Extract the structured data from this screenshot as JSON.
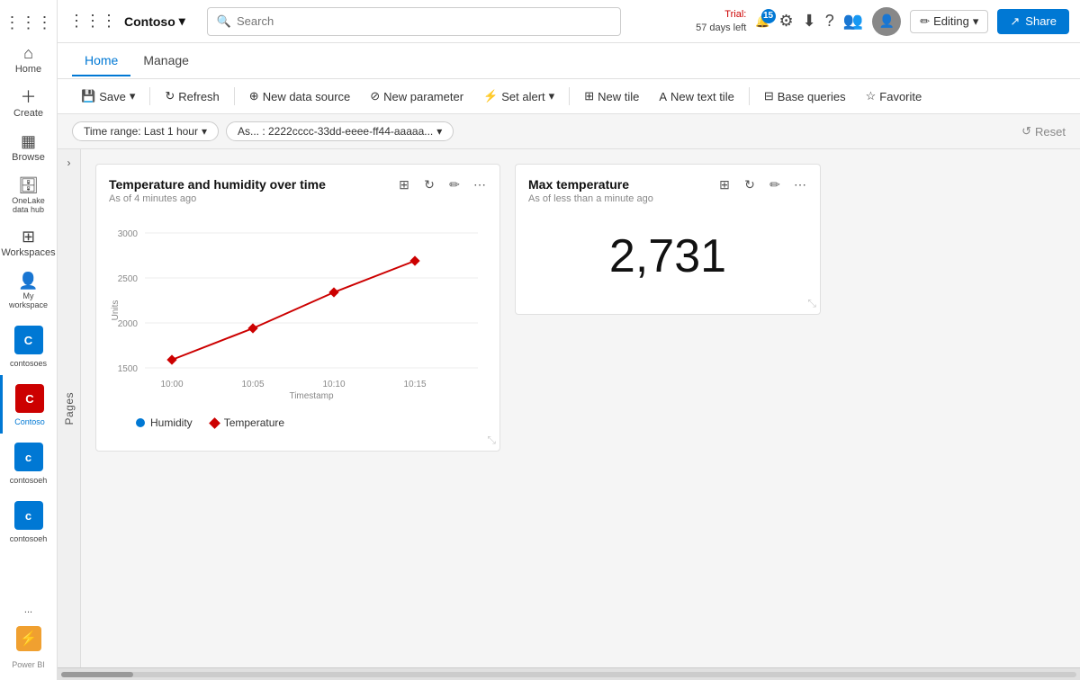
{
  "topbar": {
    "grid_icon": "⋮⋮⋮",
    "workspace": "Contoso",
    "workspace_chevron": "▾",
    "search_placeholder": "Search",
    "trial": {
      "label": "Trial:",
      "days": "57 days left"
    },
    "notification_count": "15",
    "editing_label": "Editing",
    "editing_chevron": "▾",
    "share_label": "Share",
    "share_icon": "↗"
  },
  "nav": {
    "tabs": [
      {
        "label": "Home",
        "active": true
      },
      {
        "label": "Manage",
        "active": false
      }
    ]
  },
  "toolbar": {
    "save_label": "Save",
    "refresh_label": "Refresh",
    "new_datasource_label": "New data source",
    "new_parameter_label": "New parameter",
    "set_alert_label": "Set alert",
    "new_tile_label": "New tile",
    "new_text_label": "New text tile",
    "base_queries_label": "Base queries",
    "favorite_label": "Favorite"
  },
  "filters": {
    "time_range": "Time range: Last 1 hour",
    "as_label": "As... : 2222cccc-33dd-eeee-ff44-aaaaa...",
    "reset_label": "Reset"
  },
  "sidebar": {
    "items": [
      {
        "label": "Home",
        "icon": "⌂",
        "active": false
      },
      {
        "label": "Create",
        "icon": "＋",
        "active": false
      },
      {
        "label": "Browse",
        "icon": "▦",
        "active": false
      },
      {
        "label": "OneLake data hub",
        "icon": "🗄",
        "active": false
      },
      {
        "label": "Workspaces",
        "icon": "⊞",
        "active": false
      },
      {
        "label": "My workspace",
        "icon": "👤",
        "active": false
      }
    ],
    "apps": [
      {
        "label": "contosoes",
        "letter": "C",
        "color": "#0078d4"
      },
      {
        "label": "Contoso",
        "letter": "C",
        "color": "#c00"
      },
      {
        "label": "contosoeh",
        "letter": "c",
        "color": "#0078d4"
      },
      {
        "label": "contosoeh",
        "letter": "c",
        "color": "#0078d4"
      }
    ],
    "more_label": "...",
    "powerbi_label": "Power BI"
  },
  "pages": {
    "label": "Pages",
    "chevron": "›"
  },
  "chart1": {
    "title": "Temperature and humidity over time",
    "subtitle": "As of 4 minutes ago",
    "x_labels": [
      "10:00",
      "10:05",
      "10:10",
      "10:15"
    ],
    "x_axis_label": "Timestamp",
    "y_labels": [
      "1500",
      "2000",
      "2500",
      "3000"
    ],
    "y_axis_label": "Units",
    "legend": [
      {
        "name": "Humidity",
        "color": "#0078d4",
        "shape": "circle"
      },
      {
        "name": "Temperature",
        "color": "#c00",
        "shape": "diamond"
      }
    ]
  },
  "chart2": {
    "title": "Max temperature",
    "subtitle": "As of less than a minute ago",
    "value": "2,731"
  }
}
